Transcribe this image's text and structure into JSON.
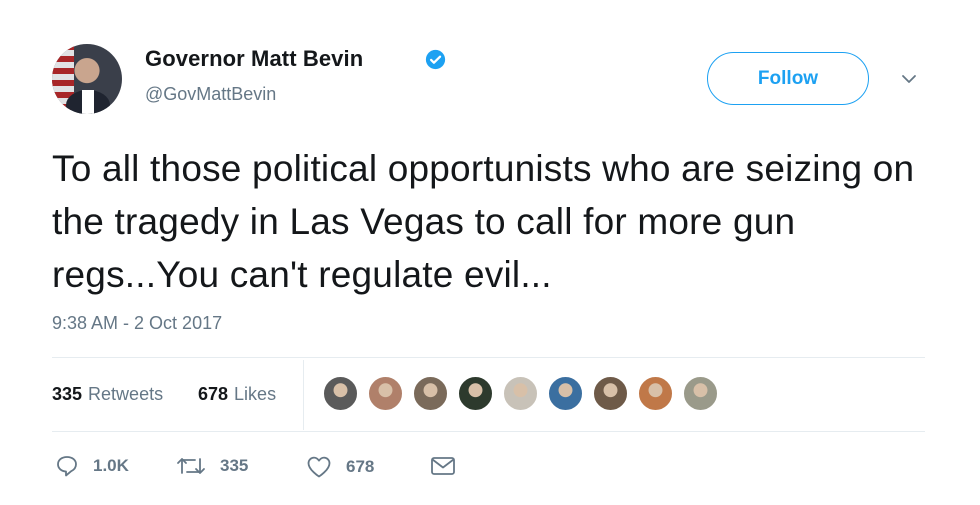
{
  "tweet": {
    "author_name": "Governor Matt Bevin",
    "author_handle": "@GovMattBevin",
    "follow_label": "Follow",
    "text": "To all those political opportunists who are seizing on the tragedy in Las Vegas to call for more gun regs...You can't regulate evil...",
    "timestamp": "9:38 AM - 2 Oct 2017",
    "retweets_count": "335",
    "retweets_label": "Retweets",
    "likes_count": "678",
    "likes_label": "Likes"
  },
  "actions": {
    "reply_count": "1.0K",
    "retweet_count": "335",
    "like_count": "678"
  },
  "likers": [
    {
      "color": "#5a5a5a"
    },
    {
      "color": "#b0806a"
    },
    {
      "color": "#7a6a5a"
    },
    {
      "color": "#2d3a2d"
    },
    {
      "color": "#c8c2b8"
    },
    {
      "color": "#3b6fa0"
    },
    {
      "color": "#6e5a48"
    },
    {
      "color": "#c07848"
    },
    {
      "color": "#9a9a8a"
    }
  ],
  "colors": {
    "accent": "#1da1f2",
    "muted": "#657786",
    "text": "#14171a"
  },
  "icons": [
    "verified-badge-icon",
    "chevron-down-icon",
    "reply-icon",
    "retweet-icon",
    "like-icon",
    "direct-message-icon"
  ]
}
